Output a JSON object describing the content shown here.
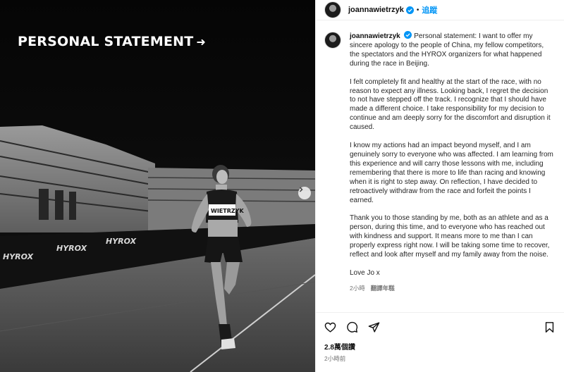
{
  "photo": {
    "overlay_title": "PERSONAL STATEMENT",
    "overlay_arrow": "➜",
    "bib_text": "WIETRZYK",
    "banner_text": "HYROX",
    "next_icon": "chevron-right-icon"
  },
  "header": {
    "username": "joannawietrzyk",
    "verified_icon": "verified-badge-icon",
    "separator": "•",
    "follow_label": "追蹤"
  },
  "caption": {
    "username": "joannawietrzyk",
    "paragraphs": [
      "Personal statement: I want to offer my sincere apology to the people of China, my fellow competitors, the spectators and the HYROX organizers for what happened during the race in Beijing.",
      "I felt completely fit and healthy at the start of the race, with no reason to expect any illness. Looking back, I regret the decision to not have stepped off the track. I recognize that I should have made a different choice. I take responsibility for my decision to continue and am deeply sorry for the discomfort and disruption it caused.",
      "I know my actions had an impact beyond myself, and I am genuinely sorry to everyone who was affected. I am learning from this experience and will carry those lessons with me, including remembering that there is more to life than racing and knowing when it is right to step away. On reflection, I have decided to retroactively withdraw from the race and forfeit the points I earned.",
      "Thank you to those standing by me, both as an athlete and as a person, during this time, and to everyone who has reached out with kindness and support. It means more to me than I can properly express right now. I will be taking some time to recover, reflect and look after myself and my family away from the noise.",
      "Love Jo x"
    ],
    "age": "2小時",
    "translate_label": "翻譯年糕"
  },
  "actions": {
    "like_icon": "heart-icon",
    "comment_icon": "comment-icon",
    "share_icon": "share-icon",
    "save_icon": "bookmark-icon"
  },
  "likes": "2.8萬個讚",
  "post_age": "2小時前",
  "colors": {
    "accent": "#0095f6",
    "verified": "#0095f6",
    "text": "#262626",
    "muted": "#737373"
  }
}
